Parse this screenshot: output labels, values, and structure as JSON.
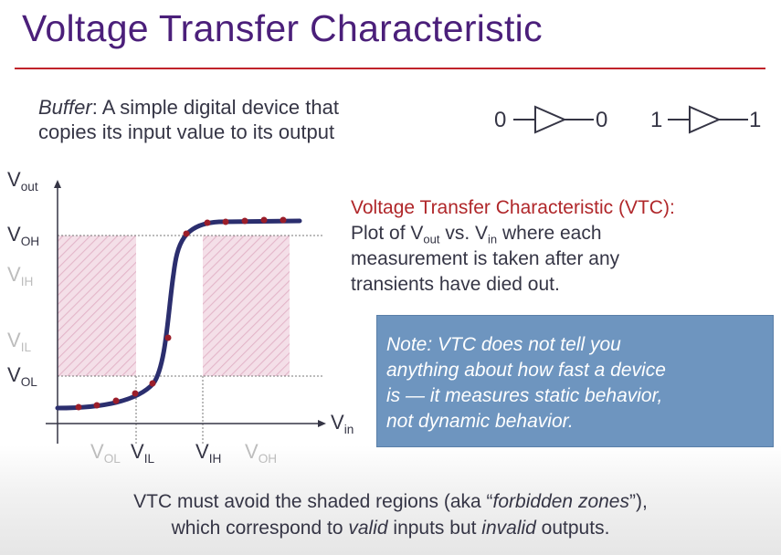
{
  "slide": {
    "title": "Voltage Transfer Characteristic"
  },
  "buffer": {
    "term": "Buffer",
    "def_line1": ": A simple digital device that",
    "def_line2": "copies its input value to its output"
  },
  "symbols": [
    {
      "input": "0",
      "output": "0"
    },
    {
      "input": "1",
      "output": "1"
    }
  ],
  "vtc_description": {
    "heading": "Voltage Transfer Characteristic (VTC):",
    "plot_of": "Plot of V",
    "out_sub": "out",
    "vs": " vs. V",
    "in_sub": "in",
    "line1_rest": " where each",
    "line2": "measurement is taken after any",
    "line3": "transients have died out."
  },
  "note": {
    "line1": "Note: VTC does not tell you",
    "line2": "anything about how fast a device",
    "line3": "is — it measures static behavior,",
    "line4": "not dynamic behavior."
  },
  "footer": {
    "l1_a": "VTC must avoid the shaded regions (aka “",
    "l1_b": "forbidden zones",
    "l1_c": "”),",
    "l2_a": "which correspond to ",
    "l2_b": "valid",
    "l2_c": " inputs but ",
    "l2_d": "invalid",
    "l2_e": " outputs."
  },
  "plot": {
    "y_axis": {
      "base": "V",
      "sub": "out"
    },
    "x_axis": {
      "base": "V",
      "sub": "in"
    },
    "y_levels": [
      {
        "base": "V",
        "sub": "OH",
        "style": "dark"
      },
      {
        "base": "V",
        "sub": "IH",
        "style": "faded"
      },
      {
        "base": "V",
        "sub": "IL",
        "style": "faded"
      },
      {
        "base": "V",
        "sub": "OL",
        "style": "dark"
      }
    ],
    "x_levels": [
      {
        "base": "V",
        "sub": "OL",
        "style": "faded"
      },
      {
        "base": "V",
        "sub": "IL",
        "style": "dark"
      },
      {
        "base": "V",
        "sub": "IH",
        "style": "dark"
      },
      {
        "base": "V",
        "sub": "OH",
        "style": "faded"
      }
    ],
    "colors": {
      "curve": "#2b2e6e",
      "points": "#9b1e2a",
      "forbidden_fill": "#f3dde6",
      "forbidden_hatch": "#e2b3c7",
      "title": "#4b1f7a",
      "rule": "#c0222a",
      "note_bg": "#6e95bf"
    }
  }
}
